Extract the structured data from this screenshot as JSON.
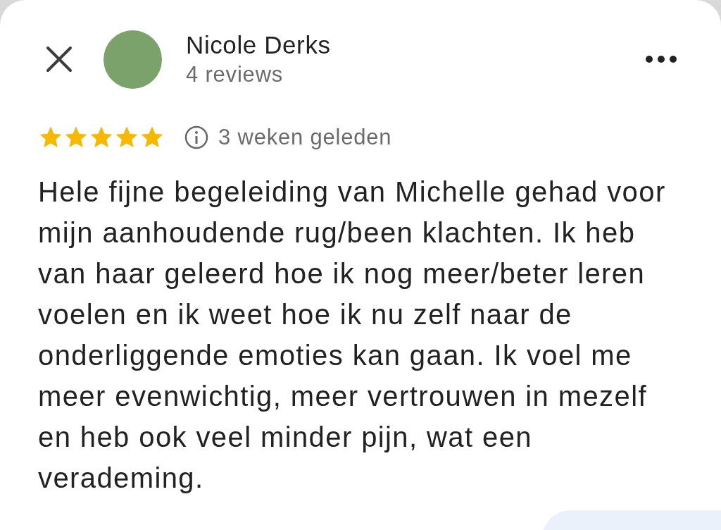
{
  "header": {
    "reviewer": {
      "name": "Nicole Derks",
      "reviews": "4 reviews"
    }
  },
  "review": {
    "stars": 5,
    "time": "3 weken geleden",
    "text": "Hele fijne begeleiding van Michelle gehad voor mijn aanhoudende rug/been klachten. Ik heb van haar geleerd hoe ik nog meer/beter leren voelen en ik weet hoe ik nu zelf naar de onderliggende emoties kan gaan. Ik voel me meer evenwichtig, meer vertrouwen in mezelf en heb ook veel minder pijn, wat een verademing."
  }
}
